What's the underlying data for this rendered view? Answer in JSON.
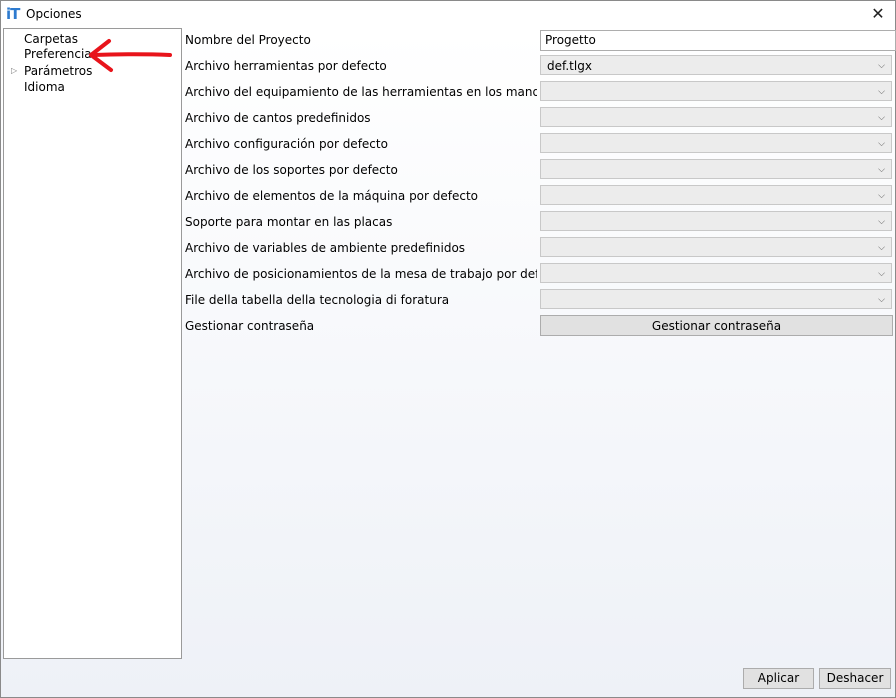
{
  "window": {
    "app_icon": "iT",
    "title": "Opciones",
    "close_glyph": "✕"
  },
  "tree": {
    "items": [
      {
        "label": "Carpetas"
      },
      {
        "label": "Preferencias"
      },
      {
        "label": "Parámetros",
        "expandable": true
      },
      {
        "label": "Idioma"
      }
    ],
    "expander_glyph": "▷"
  },
  "annotation": {
    "color": "#e8141b",
    "target": "Preferencias"
  },
  "form": {
    "project_name": {
      "label": "Nombre del Proyecto",
      "value": "Progetto"
    },
    "tools_file": {
      "label": "Archivo herramientas por defecto",
      "value": "def.tlgx"
    },
    "tool_equipment_file": {
      "label": "Archivo del equipamiento de las herramientas en los mandriles pc",
      "value": ""
    },
    "edges_file": {
      "label": "Archivo de cantos predefinidos",
      "value": ""
    },
    "config_file": {
      "label": "Archivo configuración por defecto",
      "value": ""
    },
    "supports_file": {
      "label": "Archivo de los soportes por defecto",
      "value": ""
    },
    "machine_elements_file": {
      "label": "Archivo de elementos de la máquina por defecto",
      "value": ""
    },
    "panel_support": {
      "label": "Soporte para montar en las placas",
      "value": ""
    },
    "env_variables_file": {
      "label": "Archivo de variables de ambiente predefinidos",
      "value": ""
    },
    "table_positioning_file": {
      "label": "Archivo de posicionamientos de la mesa de trabajo por defecto",
      "value": ""
    },
    "drilling_table_file": {
      "label": "File della tabella della tecnologia di foratura",
      "value": ""
    },
    "password": {
      "label": "Gestionar contraseña",
      "button_label": "Gestionar contraseña"
    }
  },
  "combo_chevron": "⌵",
  "buttons": {
    "apply": "Aplicar",
    "undo": "Deshacer"
  }
}
